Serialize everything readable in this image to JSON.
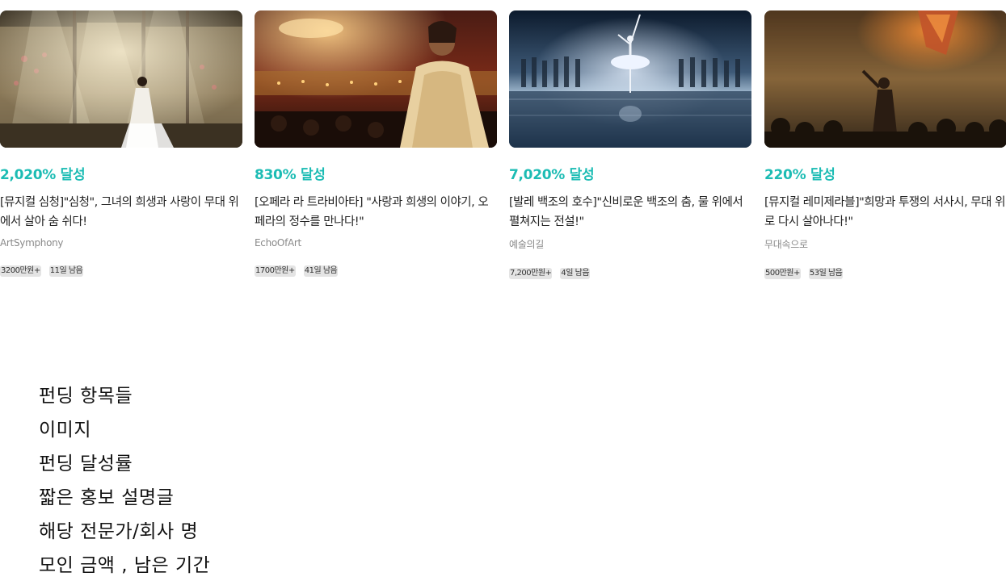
{
  "theme": {
    "accent": "#1cbcb4",
    "tag_bg": "#e4e4e4",
    "author_color": "#8a8a8a"
  },
  "cards": [
    {
      "image_icon": "musical-simcheong-stage-image",
      "rate": "2,020% 달성",
      "description": "[뮤지컬 심청]\"심청\", 그녀의 희생과 사랑이 무대 위에서 살아 숨 쉬다!",
      "author": "ArtSymphony",
      "amount": "3200만원+",
      "remaining": "11일 남음"
    },
    {
      "image_icon": "opera-la-traviata-image",
      "rate": "830% 달성",
      "description": "[오페라 라 트라비아타] \"사랑과 희생의 이야기, 오페라의 정수를 만나다!\"",
      "author": "EchoOfArt",
      "amount": "1700만원+",
      "remaining": "41일 남음"
    },
    {
      "image_icon": "ballet-swan-lake-image",
      "rate": "7,020% 달성",
      "description": "[발레 백조의 호수]\"신비로운 백조의 춤, 물 위에서 펼쳐지는 전설!\"",
      "author": "예술의길",
      "amount": "7,200만원+",
      "remaining": "4일 남음"
    },
    {
      "image_icon": "musical-les-miserables-image",
      "rate": "220% 달성",
      "description": "[뮤지컬 레미제라블]\"희망과 투쟁의 서사시, 무대 위로 다시 살아나다!\"",
      "author": "무대속으로",
      "amount": "500만원+",
      "remaining": "53일 남음"
    }
  ],
  "notes": [
    "펀딩 항목들",
    "이미지",
    "펀딩 달성률",
    "짧은 홍보 설명글",
    "해당 전문가/회사 명",
    "모인 금액 , 남은 기간"
  ]
}
